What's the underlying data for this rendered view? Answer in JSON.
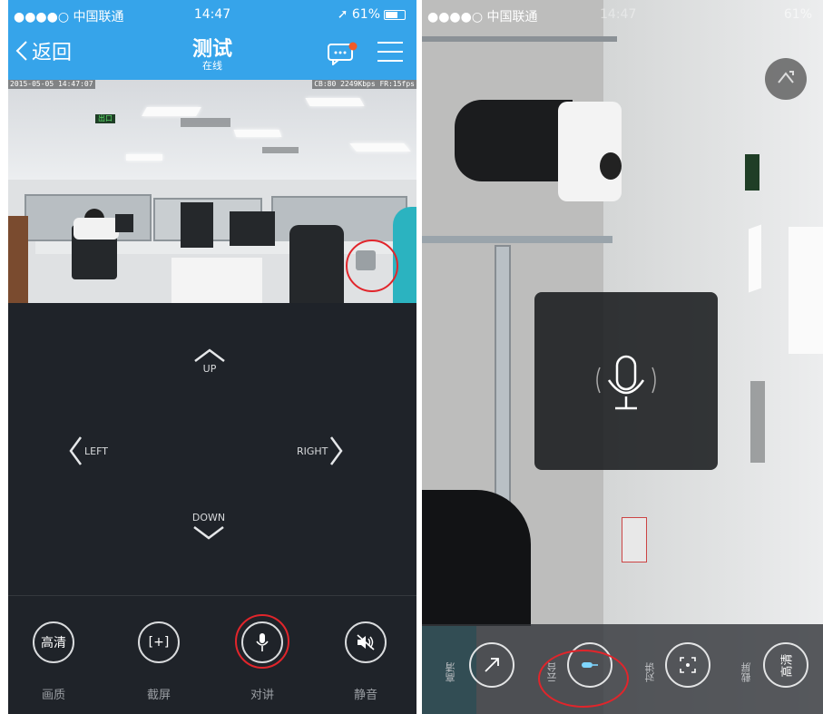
{
  "status": {
    "carrier": "●●●●○ 中国联通",
    "time": "14:47",
    "battery": "61%"
  },
  "nav": {
    "back": "返回",
    "title": "测试",
    "subtitle": "在线"
  },
  "osd": {
    "timestamp": "2015-05-05 14:47:07",
    "info": "CB:80   2249Kbps  FR:15fps"
  },
  "exit_sign": "出口",
  "ptz": {
    "up": "UP",
    "left": "LEFT",
    "right": "RIGHT",
    "down": "DOWN"
  },
  "toolbar": [
    {
      "icon": "高清",
      "label": "画质"
    },
    {
      "icon": "[+]",
      "label": "截屏"
    },
    {
      "icon": "mic",
      "label": "对讲"
    },
    {
      "icon": "mute",
      "label": "静音"
    }
  ],
  "right": {
    "status": {
      "carrier": "●●●●○ 中国联通",
      "time": "14:47",
      "battery": "61%"
    },
    "bar_labels": [
      "高清",
      "云台",
      "对讲",
      "截屏",
      "静音",
      "高清"
    ],
    "hd_button": "高清"
  },
  "colors": {
    "header": "#36a4ea",
    "panel": "#1f2329",
    "highlight": "#e1252b"
  }
}
